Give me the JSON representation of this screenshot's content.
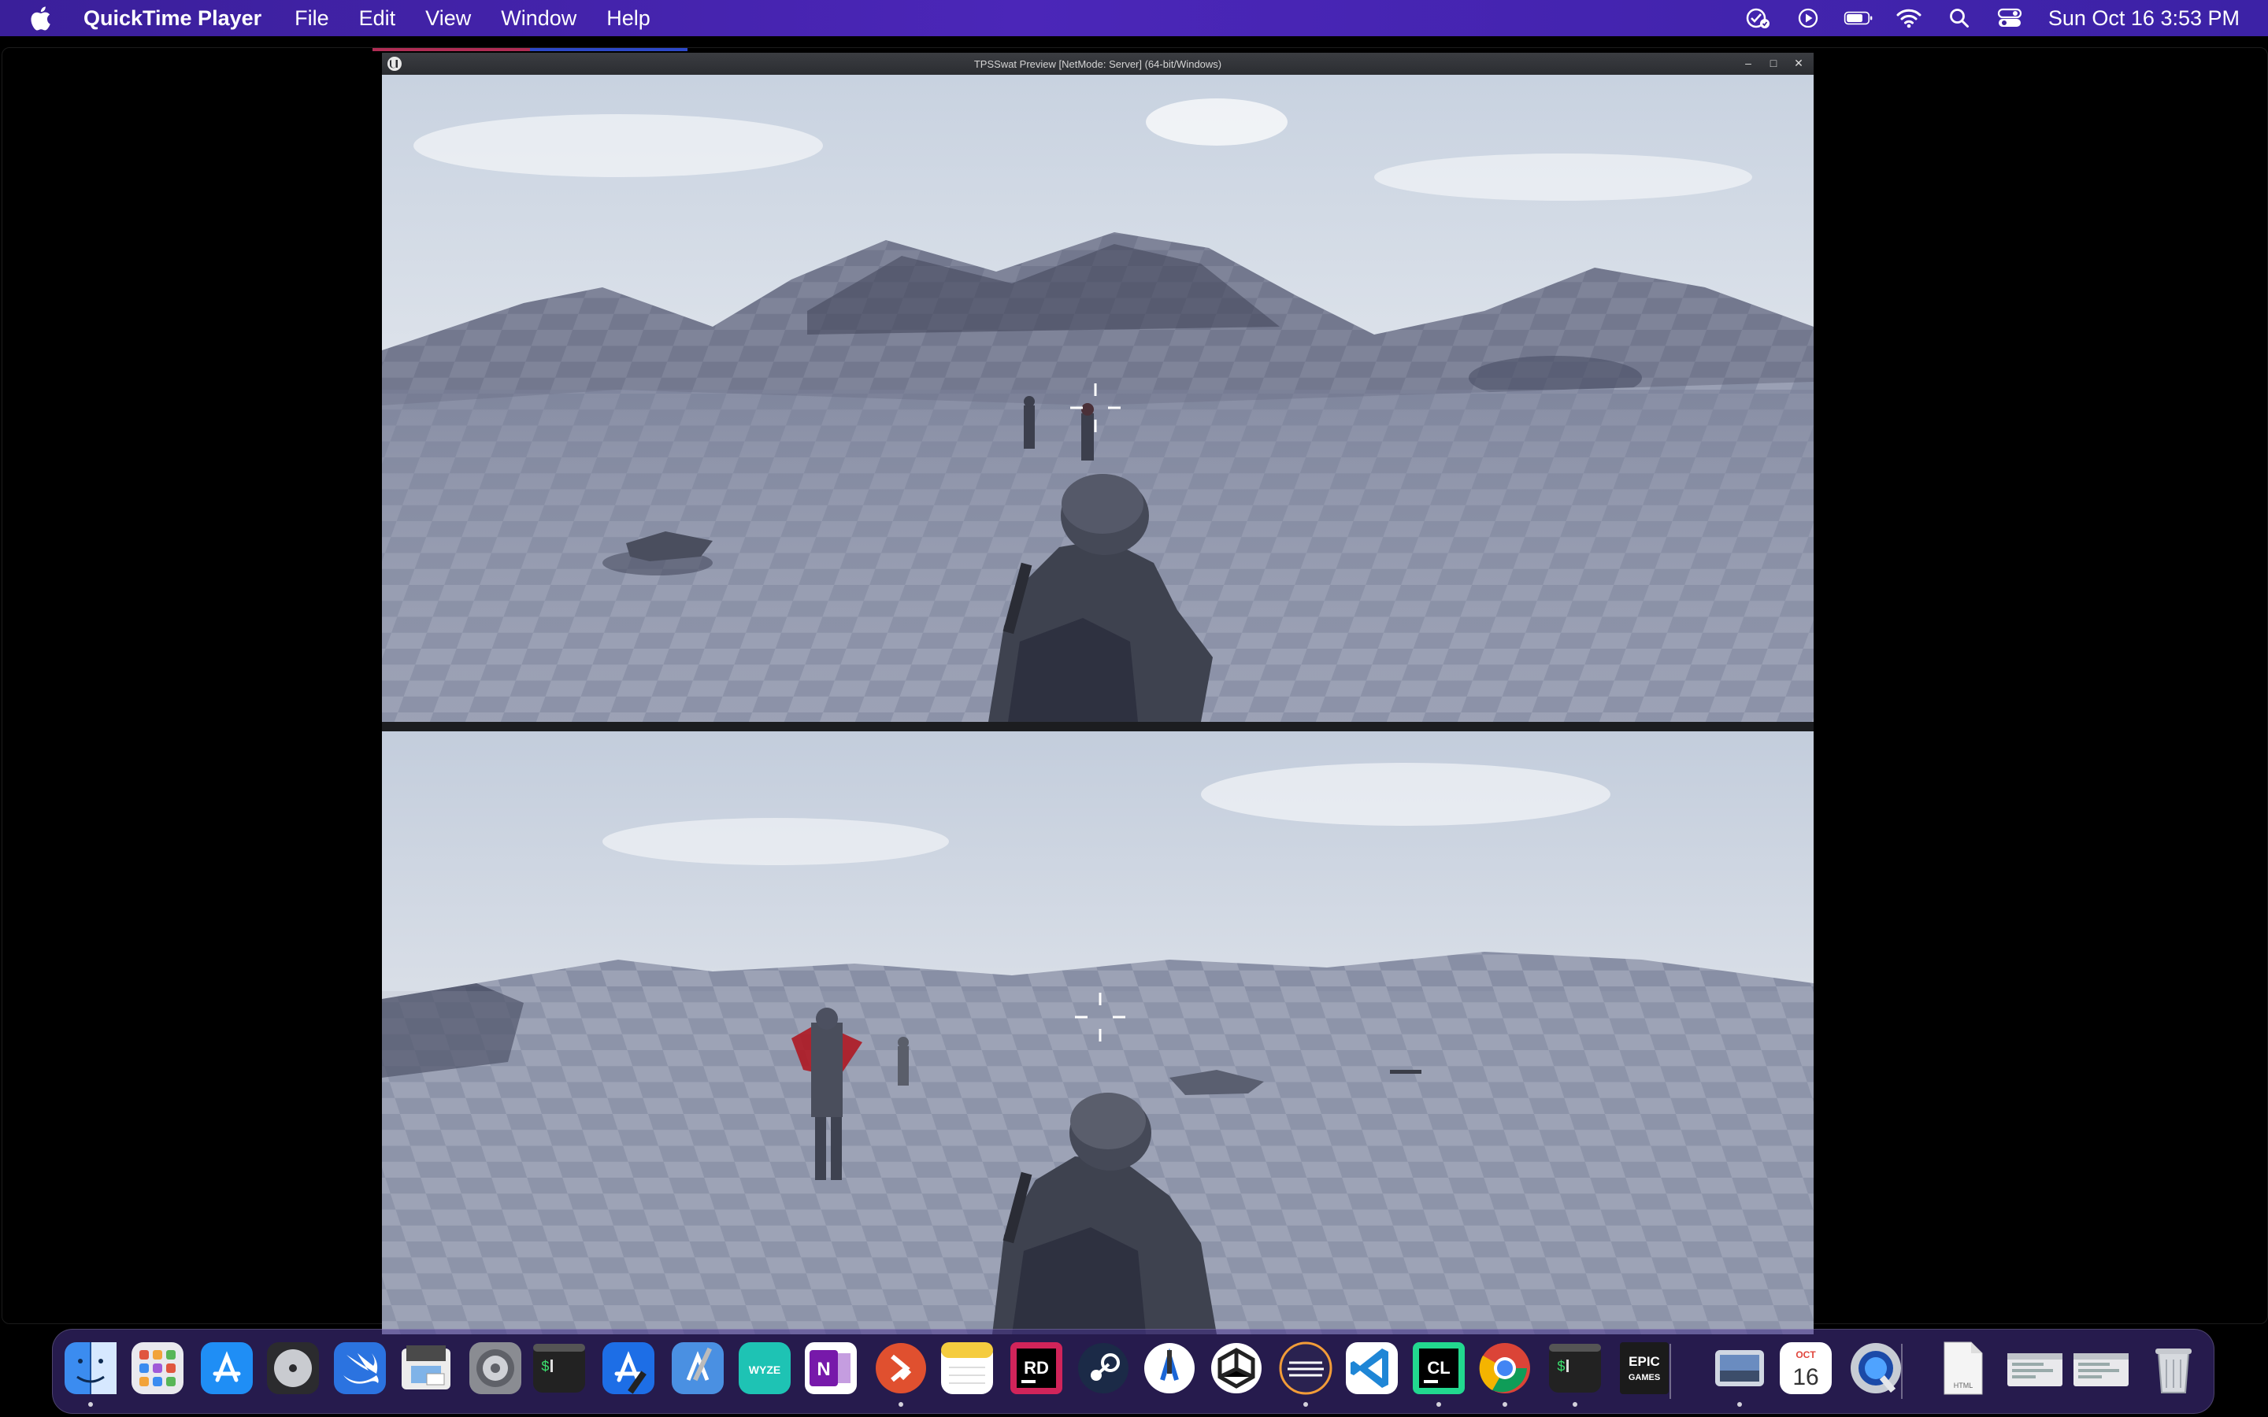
{
  "menubar": {
    "app_name": "QuickTime Player",
    "menus": [
      "File",
      "Edit",
      "View",
      "Window",
      "Help"
    ],
    "clock": "Sun Oct 16  3:53 PM",
    "status_icons": [
      "checklist-icon",
      "play-circle-icon",
      "battery-icon",
      "wifi-icon",
      "search-icon",
      "control-center-icon"
    ]
  },
  "game": {
    "title": "TPSSwat Preview [NetMode: Server]  (64-bit/Windows)",
    "window_buttons": [
      "minimize",
      "maximize",
      "close"
    ],
    "views": [
      "server-view",
      "client-view"
    ]
  },
  "dock": {
    "apps": [
      {
        "name": "Finder",
        "icon": "finder-icon"
      },
      {
        "name": "Launchpad",
        "icon": "launchpad-icon"
      },
      {
        "name": "App Store",
        "icon": "app-store-icon"
      },
      {
        "name": "Disk Utility",
        "icon": "disk-utility-icon"
      },
      {
        "name": "Swift Playgrounds",
        "icon": "swift-icon"
      },
      {
        "name": "Preview",
        "icon": "preview-icon"
      },
      {
        "name": "System Preferences",
        "icon": "system-preferences-icon"
      },
      {
        "name": "Terminal",
        "icon": "terminal-icon"
      },
      {
        "name": "Xcode",
        "icon": "xcode-icon"
      },
      {
        "name": "Xcode Instruments",
        "icon": "xcode-alt-icon"
      },
      {
        "name": "Wyze",
        "icon": "wyze-icon"
      },
      {
        "name": "OneNote",
        "icon": "onenote-icon"
      },
      {
        "name": "Remote Desktop",
        "icon": "remote-desktop-icon"
      },
      {
        "name": "Notes",
        "icon": "notes-icon"
      },
      {
        "name": "Rider",
        "icon": "rider-icon"
      },
      {
        "name": "Steam",
        "icon": "steam-icon"
      },
      {
        "name": "Instruments",
        "icon": "instruments-icon"
      },
      {
        "name": "Unity",
        "icon": "unity-icon"
      },
      {
        "name": "Setapp",
        "icon": "setapp-icon"
      },
      {
        "name": "Visual Studio Code",
        "icon": "vscode-icon"
      },
      {
        "name": "CLion",
        "icon": "clion-icon"
      },
      {
        "name": "Chrome",
        "icon": "chrome-icon"
      },
      {
        "name": "Terminal 2",
        "icon": "terminal-icon"
      },
      {
        "name": "Epic Games",
        "icon": "epic-games-icon"
      },
      {
        "name": "Preview Images",
        "icon": "photos-preview-icon"
      },
      {
        "name": "Calendar",
        "icon": "calendar-icon"
      },
      {
        "name": "QuickTime",
        "icon": "quicktime-icon"
      },
      {
        "name": "HTML Document",
        "icon": "html-file-icon"
      },
      {
        "name": "Window Preview 1",
        "icon": "window-thumb-icon"
      },
      {
        "name": "Window Preview 2",
        "icon": "window-thumb-icon"
      },
      {
        "name": "Trash",
        "icon": "trash-icon"
      }
    ],
    "labels": {
      "wyze": "WYZE",
      "rider": "RD",
      "clion": "CL",
      "epic_line1": "EPIC",
      "epic_line2": "GAMES",
      "calendar_month": "OCT",
      "calendar_day": "16",
      "html_file": "HTML",
      "terminal_prompt": "$"
    }
  }
}
